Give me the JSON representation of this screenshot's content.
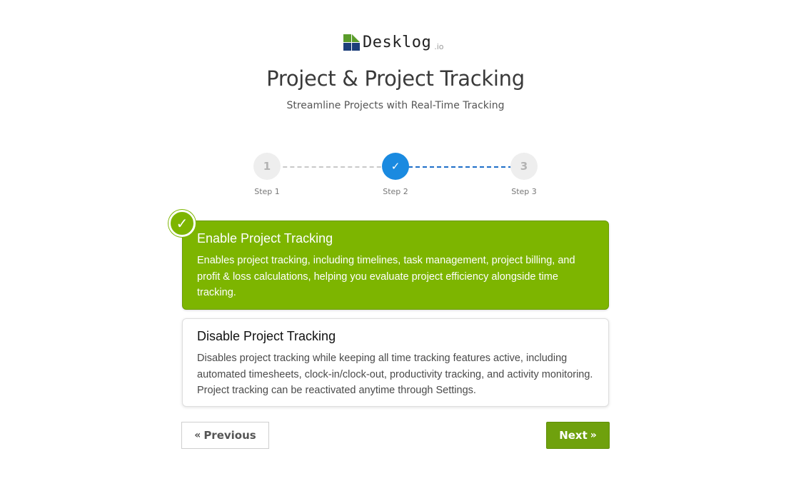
{
  "brand": {
    "name": "Desklog",
    "tld": ".io",
    "colors": {
      "green": "#5a9c2a",
      "navy": "#1c3f7a"
    }
  },
  "header": {
    "title": "Project & Project Tracking",
    "subtitle": "Streamline Projects with Real-Time Tracking"
  },
  "stepper": {
    "steps": [
      {
        "number": "1",
        "label": "Step 1",
        "state": "inactive"
      },
      {
        "number": "✓",
        "label": "Step 2",
        "state": "active"
      },
      {
        "number": "3",
        "label": "Step 3",
        "state": "inactive"
      }
    ],
    "active_color": "#1a8ae0"
  },
  "options": [
    {
      "title": "Enable Project Tracking",
      "description": "Enables project tracking, including timelines, task management, project billing, and profit & loss calculations, helping you evaluate project efficiency alongside time tracking.",
      "selected": true,
      "color": "#7db500"
    },
    {
      "title": "Disable Project Tracking",
      "description": "Disables project tracking while keeping all time tracking features active, including automated timesheets, clock-in/clock-out, productivity tracking, and activity monitoring. Project tracking can be reactivated anytime through Settings.",
      "selected": false
    }
  ],
  "selected_badge": {
    "icon": "check-icon",
    "glyph": "✓"
  },
  "nav": {
    "previous_label": "Previous",
    "previous_icon": "«",
    "next_label": "Next",
    "next_icon": "»",
    "next_color": "#6fa10d"
  }
}
